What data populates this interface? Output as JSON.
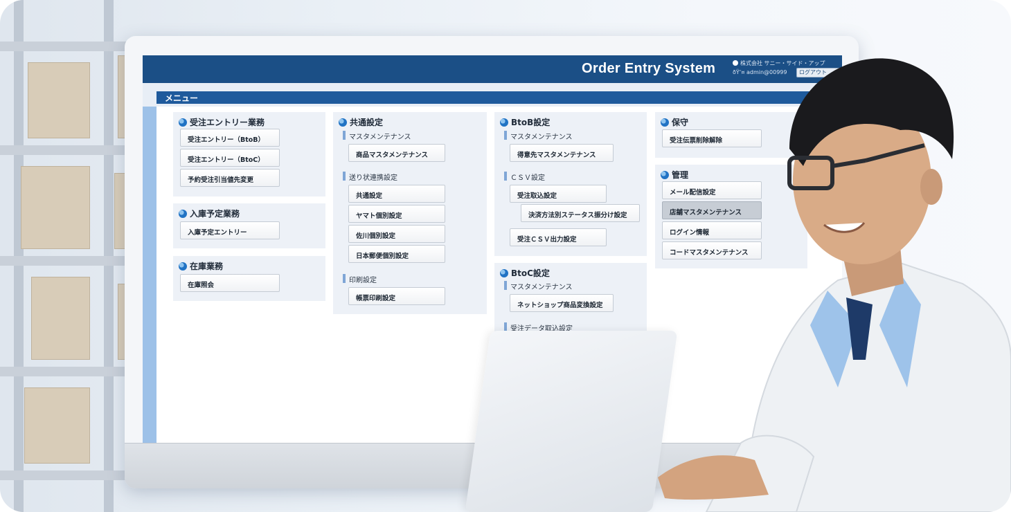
{
  "app": {
    "title": "Order Entry System",
    "user_company": "株式会社 サニー・サイド・アップ",
    "user_id": "admin@00999",
    "logout_label": "ログアウト"
  },
  "menu": {
    "title": "メニュー"
  },
  "columns": [
    {
      "sections": [
        {
          "title": "受注エントリー業務",
          "buttons": [
            "受注エントリー（BtoB）",
            "受注エントリー（BtoC）",
            "予約受注引当値先変更"
          ]
        },
        {
          "title": "入庫予定業務",
          "buttons": [
            "入庫予定エントリー"
          ]
        },
        {
          "title": "在庫業務",
          "buttons": [
            "在庫照会"
          ]
        }
      ]
    },
    {
      "sections": [
        {
          "title": "共通設定",
          "groups": [
            {
              "label": "マスタメンテナンス",
              "buttons": [
                "商品マスタメンテナンス"
              ]
            },
            {
              "label": "送り状連携設定",
              "buttons": [
                "共通設定",
                "ヤマト個別設定",
                "佐川個別設定",
                "日本郵便個別設定"
              ]
            },
            {
              "label": "印刷設定",
              "buttons": [
                "帳票印刷設定"
              ]
            }
          ]
        }
      ]
    },
    {
      "sections": [
        {
          "title": "BtoB設定",
          "groups": [
            {
              "label": "マスタメンテナンス",
              "buttons": [
                "得意先マスタメンテナンス"
              ]
            },
            {
              "label": "ＣＳＶ設定",
              "buttons": [
                "受注取込設定",
                "決済方法別ステータス振分け設定",
                "受注ＣＳＶ出力設定"
              ]
            }
          ]
        },
        {
          "title": "BtoC設定",
          "groups": [
            {
              "label": "マスタメンテナンス",
              "buttons": [
                "ネットショップ商品変換設定"
              ]
            },
            {
              "label": "受注データ取込設定",
              "buttons": [
                ""
              ]
            }
          ]
        }
      ]
    },
    {
      "sections": [
        {
          "title": "保守",
          "buttons": [
            "受注伝票削除解除"
          ]
        },
        {
          "title": "管理",
          "buttons": [
            "メール配信設定",
            "店舗マスタメンテナンス",
            "ログイン情報",
            "コードマスタメンテナンス"
          ]
        }
      ]
    }
  ]
}
